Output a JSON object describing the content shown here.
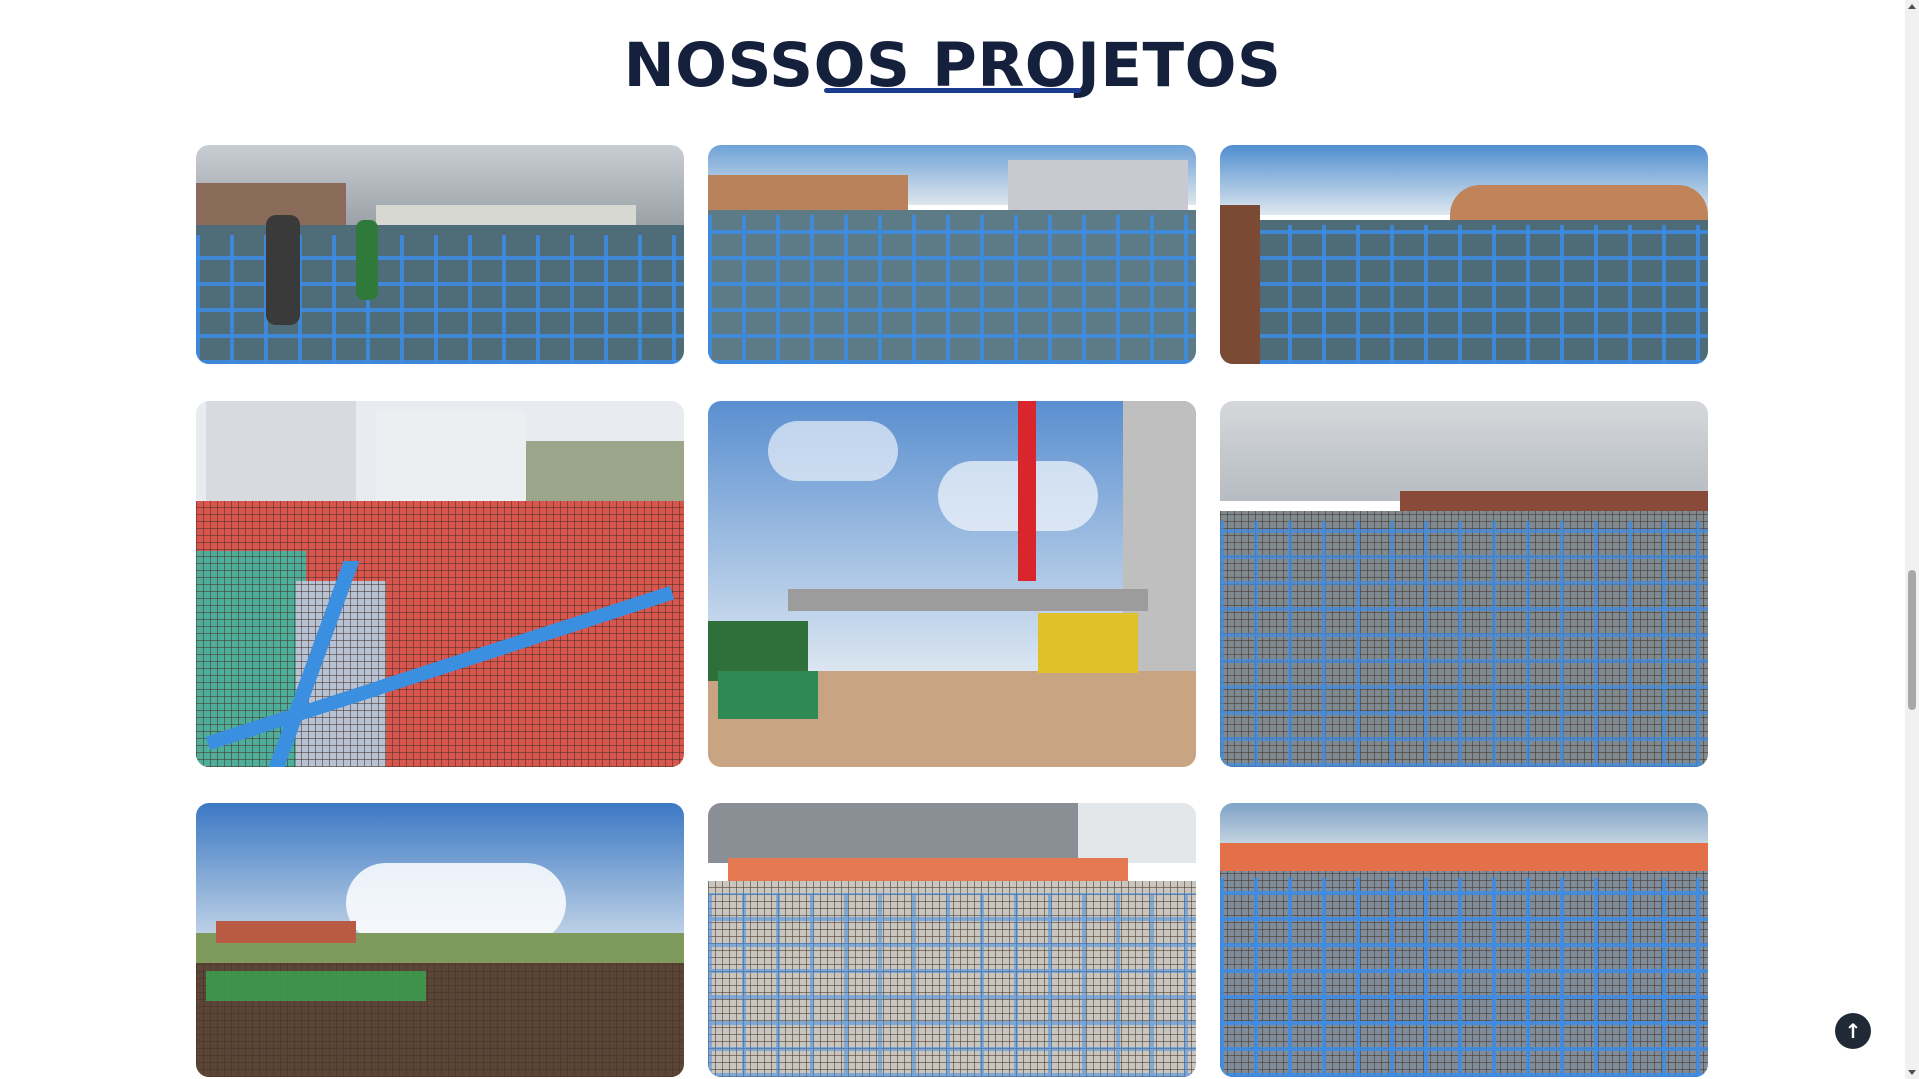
{
  "section": {
    "title": "NOSSOS PROJETOS"
  },
  "gallery": {
    "photos": [
      {
        "name": "project-photo-1",
        "scene": "waffle-slab"
      },
      {
        "name": "project-photo-2",
        "scene": "waffle-slab"
      },
      {
        "name": "project-photo-3",
        "scene": "waffle-slab"
      },
      {
        "name": "project-photo-4",
        "scene": "red-formwork"
      },
      {
        "name": "project-photo-5",
        "scene": "crane-lift"
      },
      {
        "name": "project-photo-6",
        "scene": "blue-grid-slab"
      },
      {
        "name": "project-photo-7",
        "scene": "rebar-mesh-roof"
      },
      {
        "name": "project-photo-8",
        "scene": "rebar-mesh-slab"
      },
      {
        "name": "project-photo-9",
        "scene": "blue-grid-slab"
      }
    ]
  },
  "colors": {
    "title": "#15213c",
    "underline": "#1a3d8f",
    "back_to_top_bg": "#1f2a36"
  },
  "icons": {
    "back_to_top": "arrow-up-icon",
    "back_to_top_glyph": "↑"
  }
}
